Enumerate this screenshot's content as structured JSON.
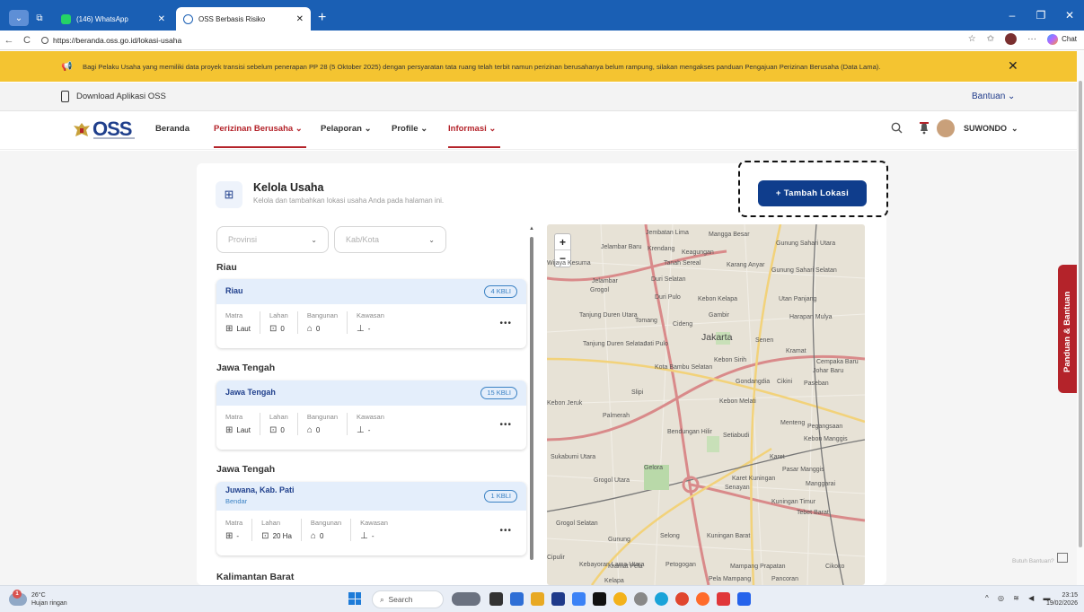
{
  "browser": {
    "tabs": [
      {
        "label": "(146) WhatsApp",
        "active": false
      },
      {
        "label": "OSS Berbasis Risiko",
        "active": true
      }
    ],
    "url": "https://beranda.oss.go.id/lokasi-usaha",
    "chat_label": "Chat"
  },
  "banner": {
    "text": "Bagi Pelaku Usaha yang memiliki data proyek transisi sebelum penerapan PP 28 (5 Oktober 2025) dengan persyaratan tata ruang telah terbit namun perizinan berusahanya belum rampung, silakan mengakses panduan Pengajuan Perizinan Berusaha (Data Lama)."
  },
  "topbar": {
    "download_label": "Download Aplikasi OSS",
    "bantuan_label": "Bantuan"
  },
  "nav": {
    "logo_text": "OSS",
    "items": [
      "Beranda",
      "Perizinan Berusaha",
      "Pelaporan",
      "Profile",
      "Informasi"
    ],
    "user": "SUWONDO"
  },
  "page": {
    "title": "Kelola Usaha",
    "subtitle": "Kelola dan tambahkan lokasi usaha Anda pada halaman ini.",
    "add_button": "+ Tambah Lokasi",
    "filter_provinsi": "Provinsi",
    "filter_kabkota": "Kab/Kota",
    "stat_labels": [
      "Matra",
      "Lahan",
      "Bangunan",
      "Kawasan"
    ],
    "groups": [
      {
        "title": "Riau",
        "location": "Riau",
        "sub": "",
        "kbli": "4 KBLI",
        "values": [
          "Laut",
          "0",
          "0",
          "-"
        ]
      },
      {
        "title": "Jawa Tengah",
        "location": "Jawa Tengah",
        "sub": "",
        "kbli": "15 KBLI",
        "values": [
          "Laut",
          "0",
          "0",
          "-"
        ]
      },
      {
        "title": "Jawa Tengah",
        "location": "Juwana, Kab. Pati",
        "sub": "Bendar",
        "kbli": "1 KBLI",
        "values": [
          "-",
          "20 Ha",
          "0",
          "-"
        ]
      }
    ],
    "next_group_title": "Kalimantan Barat"
  },
  "map": {
    "labels": [
      "Jembatan Lima",
      "Mangga Besar",
      "Jelambar Baru",
      "Krendang",
      "Keagungan",
      "Gunung Sahari Utara",
      "Wijaya Kesuma",
      "Tanah Sereal",
      "Karang Anyar",
      "Jelambar",
      "Duri Selatan",
      "Grogol",
      "Gunung Sahari Selatan",
      "Duri Pulo",
      "Kebon Kelapa",
      "Utan Panjang",
      "Tanjung Duren Utara",
      "Tomang",
      "Gambir",
      "Cideng",
      "Harapan Mulya",
      "Jakarta",
      "Senen",
      "Tanjung Duren Selatan",
      "Jati Pulo",
      "Kramat",
      "Cempaka Baru",
      "Kebon Sirih",
      "Johar Baru",
      "Kota Bambu Selatan",
      "Gondangdia",
      "Cikini",
      "Paseban",
      "Kebon Jeruk",
      "Slipi",
      "Kebon Melati",
      "Palmerah",
      "Menteng",
      "Pegangsaan",
      "Bendungan Hilir",
      "Setiabudi",
      "Kebon Manggis",
      "Sukabumi Utara",
      "Karet",
      "Pasar Manggis",
      "Grogol Utara",
      "Gelora",
      "Senayan",
      "Karet Kuningan",
      "Manggarai",
      "Kuningan Timur",
      "Tebet Barat",
      "Grogol Selatan",
      "Selong",
      "Kuningan Barat",
      "Gunung",
      "Cipulir",
      "Kebayoran Lama Utara",
      "Kramat Pela",
      "Petogogan",
      "Mampang Prapatan",
      "Pancoran",
      "Cikoko",
      "Pela Mampang",
      "Kelapa"
    ],
    "label_big": "Jakarta"
  },
  "side_panel": {
    "label": "Panduan & Bantuan",
    "help_text": "Butuh Bantuan?"
  },
  "taskbar": {
    "temperature": "26°C",
    "weather": "Hujan ringan",
    "search": "Search",
    "time": "23:15",
    "date": "19/02/2026"
  },
  "colors": {
    "primary": "#0f3d8c",
    "accent_red": "#b4232a",
    "banner": "#f4c431",
    "browser_blue": "#1a5fb4"
  }
}
